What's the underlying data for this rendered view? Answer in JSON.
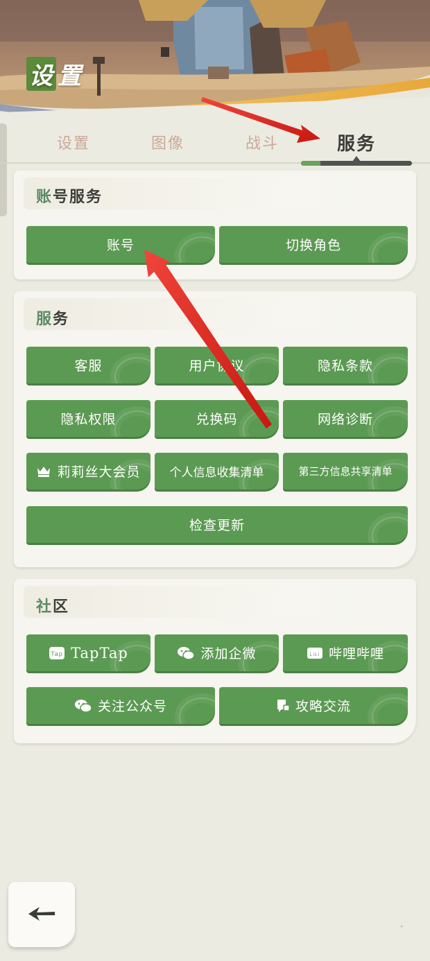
{
  "header": {
    "title_first_char": "设",
    "title_rest": "置"
  },
  "tabs": [
    {
      "label": "设置",
      "active": false
    },
    {
      "label": "图像",
      "active": false
    },
    {
      "label": "战斗",
      "active": false
    },
    {
      "label": "服务",
      "active": true
    }
  ],
  "sections": {
    "account": {
      "title_first": "账",
      "title_rest": "号服务",
      "buttons": [
        "账号",
        "切换角色"
      ]
    },
    "service": {
      "title_first": "服",
      "title_rest": "务",
      "buttons": [
        "客服",
        "用户协议",
        "隐私条款",
        "隐私权限",
        "兑换码",
        "网络诊断",
        "莉莉丝大会员",
        "个人信息收集清单",
        "第三方信息共享清单",
        "检查更新"
      ]
    },
    "community": {
      "title_first": "社",
      "title_rest": "区",
      "buttons": [
        "TapTap",
        "添加企微",
        "哔哩哔哩",
        "关注公众号",
        "攻略交流"
      ]
    }
  },
  "icons": {
    "crown": "crown-icon",
    "taptap": "taptap-icon",
    "wechat": "wechat-icon",
    "bilibili": "bilibili-icon",
    "chat": "chat-icon",
    "back": "back-arrow-icon"
  },
  "icon_text": {
    "taptap": "Tap",
    "bilibili": "LiLi"
  },
  "colors": {
    "button": "#5b9a52",
    "card": "#f6f5ef",
    "page": "#ecebe2",
    "annotation_arrow": "#e0241c"
  }
}
